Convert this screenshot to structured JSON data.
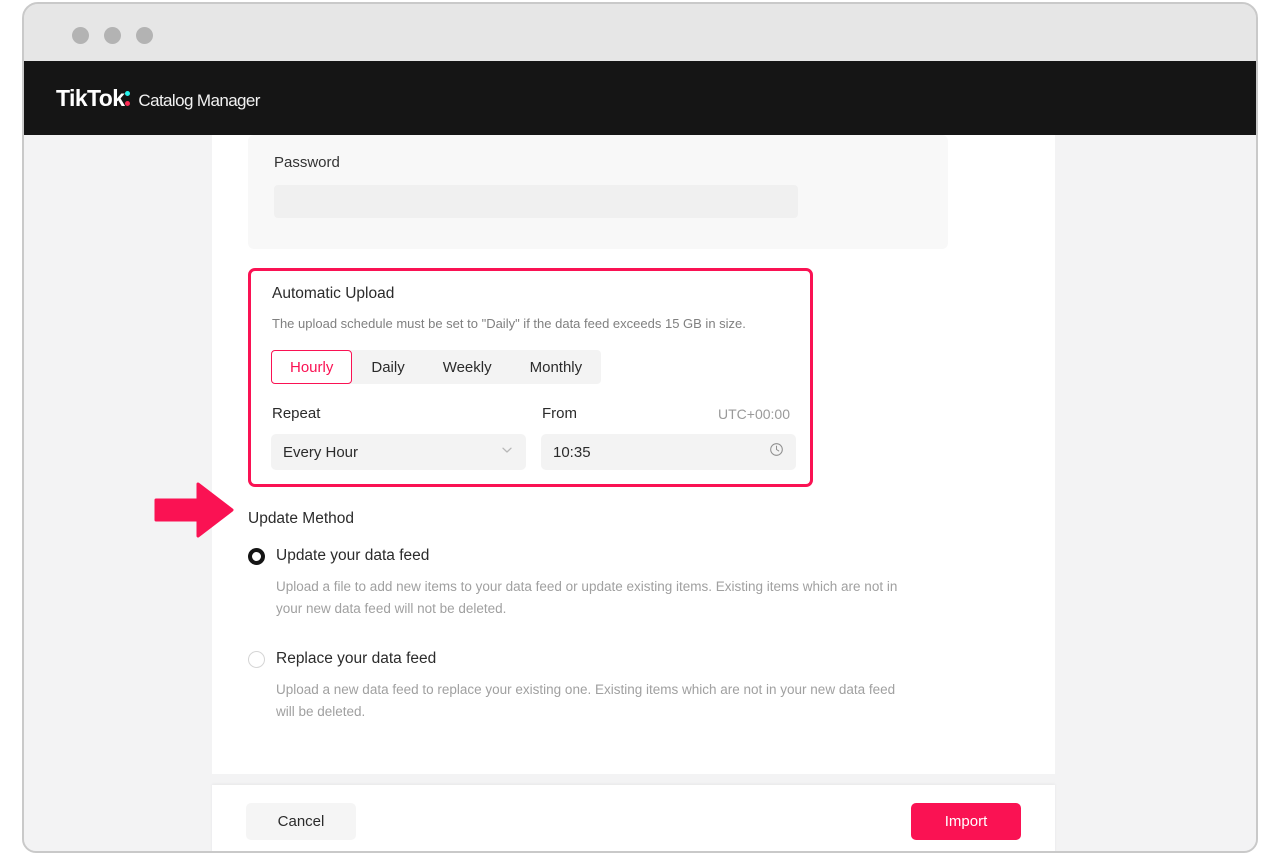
{
  "window": {
    "traffic_lights": [
      "close",
      "minimize",
      "maximize"
    ]
  },
  "header": {
    "brand": "TikTok",
    "subtitle": "Catalog Manager",
    "brand_colors": {
      "cyan": "#25f4ee",
      "pink": "#fe2c55",
      "background": "#151515"
    }
  },
  "credentials": {
    "password_label": "Password",
    "password_value": "",
    "password_placeholder": ""
  },
  "automatic_upload": {
    "title": "Automatic Upload",
    "description": "The upload schedule must be set to \"Daily\" if the data feed exceeds 15 GB in size.",
    "highlight_color": "#fa1253",
    "frequency_tabs": [
      {
        "label": "Hourly",
        "active": true
      },
      {
        "label": "Daily",
        "active": false
      },
      {
        "label": "Weekly",
        "active": false
      },
      {
        "label": "Monthly",
        "active": false
      }
    ],
    "repeat": {
      "label": "Repeat",
      "value": "Every Hour",
      "options": [
        "Every Hour"
      ]
    },
    "from": {
      "label": "From",
      "value": "10:35",
      "timezone": "UTC+00:00",
      "icon": "clock-icon"
    }
  },
  "update_method": {
    "title": "Update Method",
    "options": [
      {
        "label": "Update your data feed",
        "selected": true,
        "help": "Upload a file to add new items to your data feed or update existing items. Existing items which are not in your new data feed will not be deleted."
      },
      {
        "label": "Replace your data feed",
        "selected": false,
        "help": "Upload a new data feed to replace your existing one. Existing items which are not in your new data feed will be deleted."
      }
    ]
  },
  "footer": {
    "cancel_label": "Cancel",
    "import_label": "Import",
    "import_color": "#fa1253"
  },
  "annotation": {
    "arrow": "right-arrow",
    "color": "#fa1253"
  }
}
